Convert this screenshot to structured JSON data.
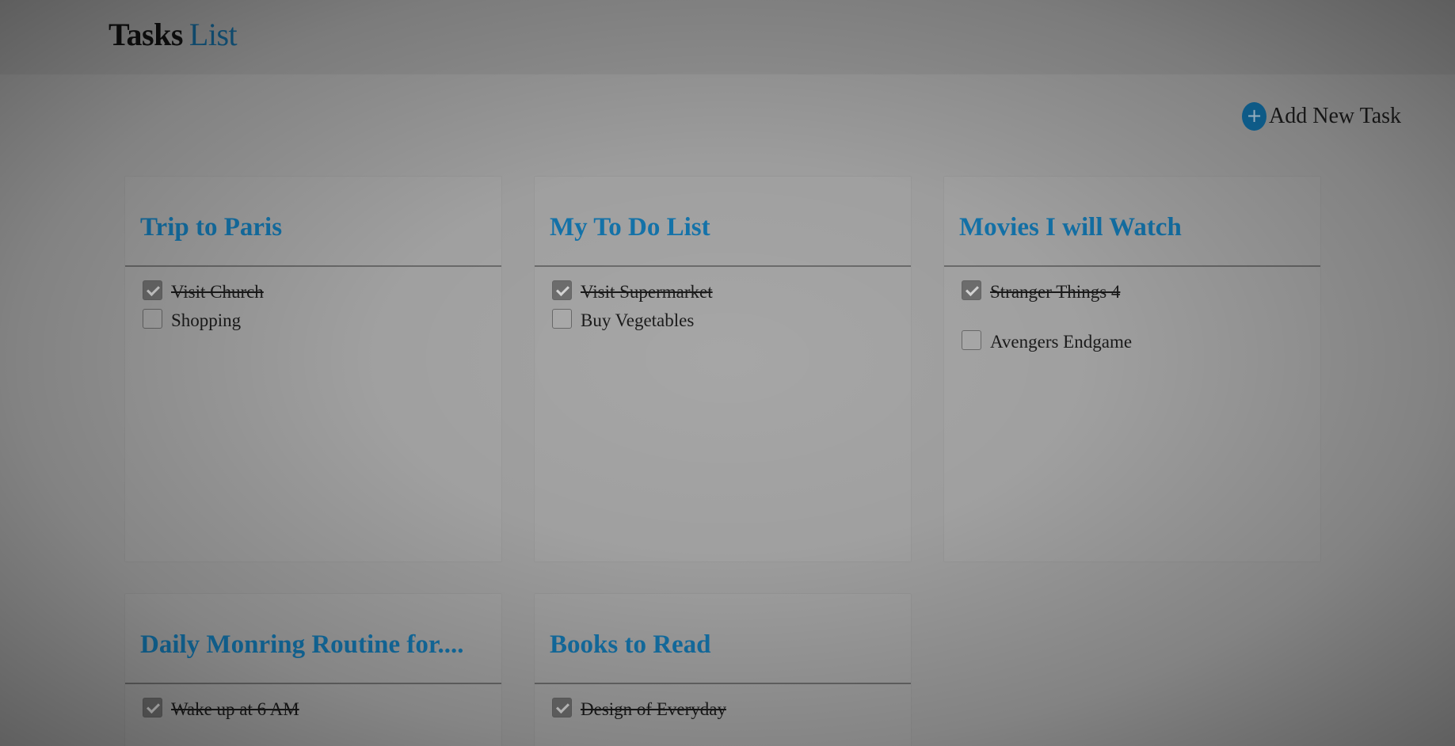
{
  "app": {
    "title_part1": "Tasks",
    "title_part2": "List"
  },
  "toolbar": {
    "add_icon": "+",
    "add_label": "Add New Task"
  },
  "colors": {
    "accent": "#1475ad",
    "heading": "#111111"
  },
  "cards": [
    {
      "title": "Trip to Paris",
      "tasks": [
        {
          "label": "Visit Church",
          "done": true
        },
        {
          "label": "Shopping",
          "done": false
        }
      ]
    },
    {
      "title": "My To Do List",
      "tasks": [
        {
          "label": "Visit Supermarket",
          "done": true
        },
        {
          "label": "Buy Vegetables",
          "done": false
        }
      ]
    },
    {
      "title": "Movies I will Watch",
      "tasks": [
        {
          "label": "Stranger Things 4",
          "done": true
        },
        {
          "label": "Avengers Endgame",
          "done": false
        }
      ]
    },
    {
      "title": "Daily Monring Routine for....",
      "tasks": [
        {
          "label": "Wake up at 6 AM",
          "done": true
        }
      ]
    },
    {
      "title": "Books to Read",
      "tasks": [
        {
          "label": "Design of Everyday",
          "done": true
        }
      ]
    }
  ]
}
